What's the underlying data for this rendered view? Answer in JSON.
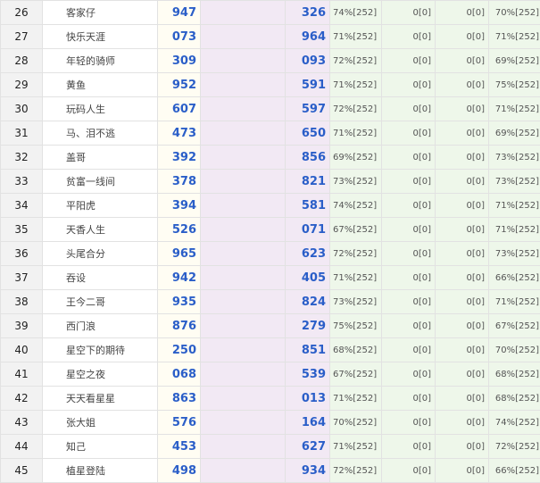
{
  "rows": [
    {
      "rank": "26",
      "name": "客家仔",
      "a": "947",
      "b": "326",
      "p1": "74%[252]",
      "z1": "0[0]",
      "z2": "0[0]",
      "p2": "70%[252]"
    },
    {
      "rank": "27",
      "name": "快乐天涯",
      "a": "073",
      "b": "964",
      "p1": "71%[252]",
      "z1": "0[0]",
      "z2": "0[0]",
      "p2": "71%[252]"
    },
    {
      "rank": "28",
      "name": "年轻的骑师",
      "a": "309",
      "b": "093",
      "p1": "72%[252]",
      "z1": "0[0]",
      "z2": "0[0]",
      "p2": "69%[252]"
    },
    {
      "rank": "29",
      "name": "黄鱼",
      "a": "952",
      "b": "591",
      "p1": "71%[252]",
      "z1": "0[0]",
      "z2": "0[0]",
      "p2": "75%[252]"
    },
    {
      "rank": "30",
      "name": "玩码人生",
      "a": "607",
      "b": "597",
      "p1": "72%[252]",
      "z1": "0[0]",
      "z2": "0[0]",
      "p2": "71%[252]"
    },
    {
      "rank": "31",
      "name": "马、泪不逃",
      "a": "473",
      "b": "650",
      "p1": "71%[252]",
      "z1": "0[0]",
      "z2": "0[0]",
      "p2": "69%[252]"
    },
    {
      "rank": "32",
      "name": "盖哥",
      "a": "392",
      "b": "856",
      "p1": "69%[252]",
      "z1": "0[0]",
      "z2": "0[0]",
      "p2": "73%[252]"
    },
    {
      "rank": "33",
      "name": "贫富一线间",
      "a": "378",
      "b": "821",
      "p1": "73%[252]",
      "z1": "0[0]",
      "z2": "0[0]",
      "p2": "73%[252]"
    },
    {
      "rank": "34",
      "name": "平阳虎",
      "a": "394",
      "b": "581",
      "p1": "74%[252]",
      "z1": "0[0]",
      "z2": "0[0]",
      "p2": "71%[252]"
    },
    {
      "rank": "35",
      "name": "天香人生",
      "a": "526",
      "b": "071",
      "p1": "67%[252]",
      "z1": "0[0]",
      "z2": "0[0]",
      "p2": "71%[252]"
    },
    {
      "rank": "36",
      "name": "头尾合分",
      "a": "965",
      "b": "623",
      "p1": "72%[252]",
      "z1": "0[0]",
      "z2": "0[0]",
      "p2": "73%[252]"
    },
    {
      "rank": "37",
      "name": "吞设",
      "a": "942",
      "b": "405",
      "p1": "71%[252]",
      "z1": "0[0]",
      "z2": "0[0]",
      "p2": "66%[252]"
    },
    {
      "rank": "38",
      "name": "王今二哥",
      "a": "935",
      "b": "824",
      "p1": "73%[252]",
      "z1": "0[0]",
      "z2": "0[0]",
      "p2": "71%[252]"
    },
    {
      "rank": "39",
      "name": "西门浪",
      "a": "876",
      "b": "279",
      "p1": "75%[252]",
      "z1": "0[0]",
      "z2": "0[0]",
      "p2": "67%[252]"
    },
    {
      "rank": "40",
      "name": "星空下的期待",
      "a": "250",
      "b": "851",
      "p1": "68%[252]",
      "z1": "0[0]",
      "z2": "0[0]",
      "p2": "70%[252]"
    },
    {
      "rank": "41",
      "name": "星空之夜",
      "a": "068",
      "b": "539",
      "p1": "67%[252]",
      "z1": "0[0]",
      "z2": "0[0]",
      "p2": "68%[252]"
    },
    {
      "rank": "42",
      "name": "天天看星星",
      "a": "863",
      "b": "013",
      "p1": "71%[252]",
      "z1": "0[0]",
      "z2": "0[0]",
      "p2": "68%[252]"
    },
    {
      "rank": "43",
      "name": "张大姐",
      "a": "576",
      "b": "164",
      "p1": "70%[252]",
      "z1": "0[0]",
      "z2": "0[0]",
      "p2": "74%[252]"
    },
    {
      "rank": "44",
      "name": "知己",
      "a": "453",
      "b": "627",
      "p1": "71%[252]",
      "z1": "0[0]",
      "z2": "0[0]",
      "p2": "72%[252]"
    },
    {
      "rank": "45",
      "name": "植星登陆",
      "a": "498",
      "b": "934",
      "p1": "72%[252]",
      "z1": "0[0]",
      "z2": "0[0]",
      "p2": "66%[252]"
    }
  ]
}
